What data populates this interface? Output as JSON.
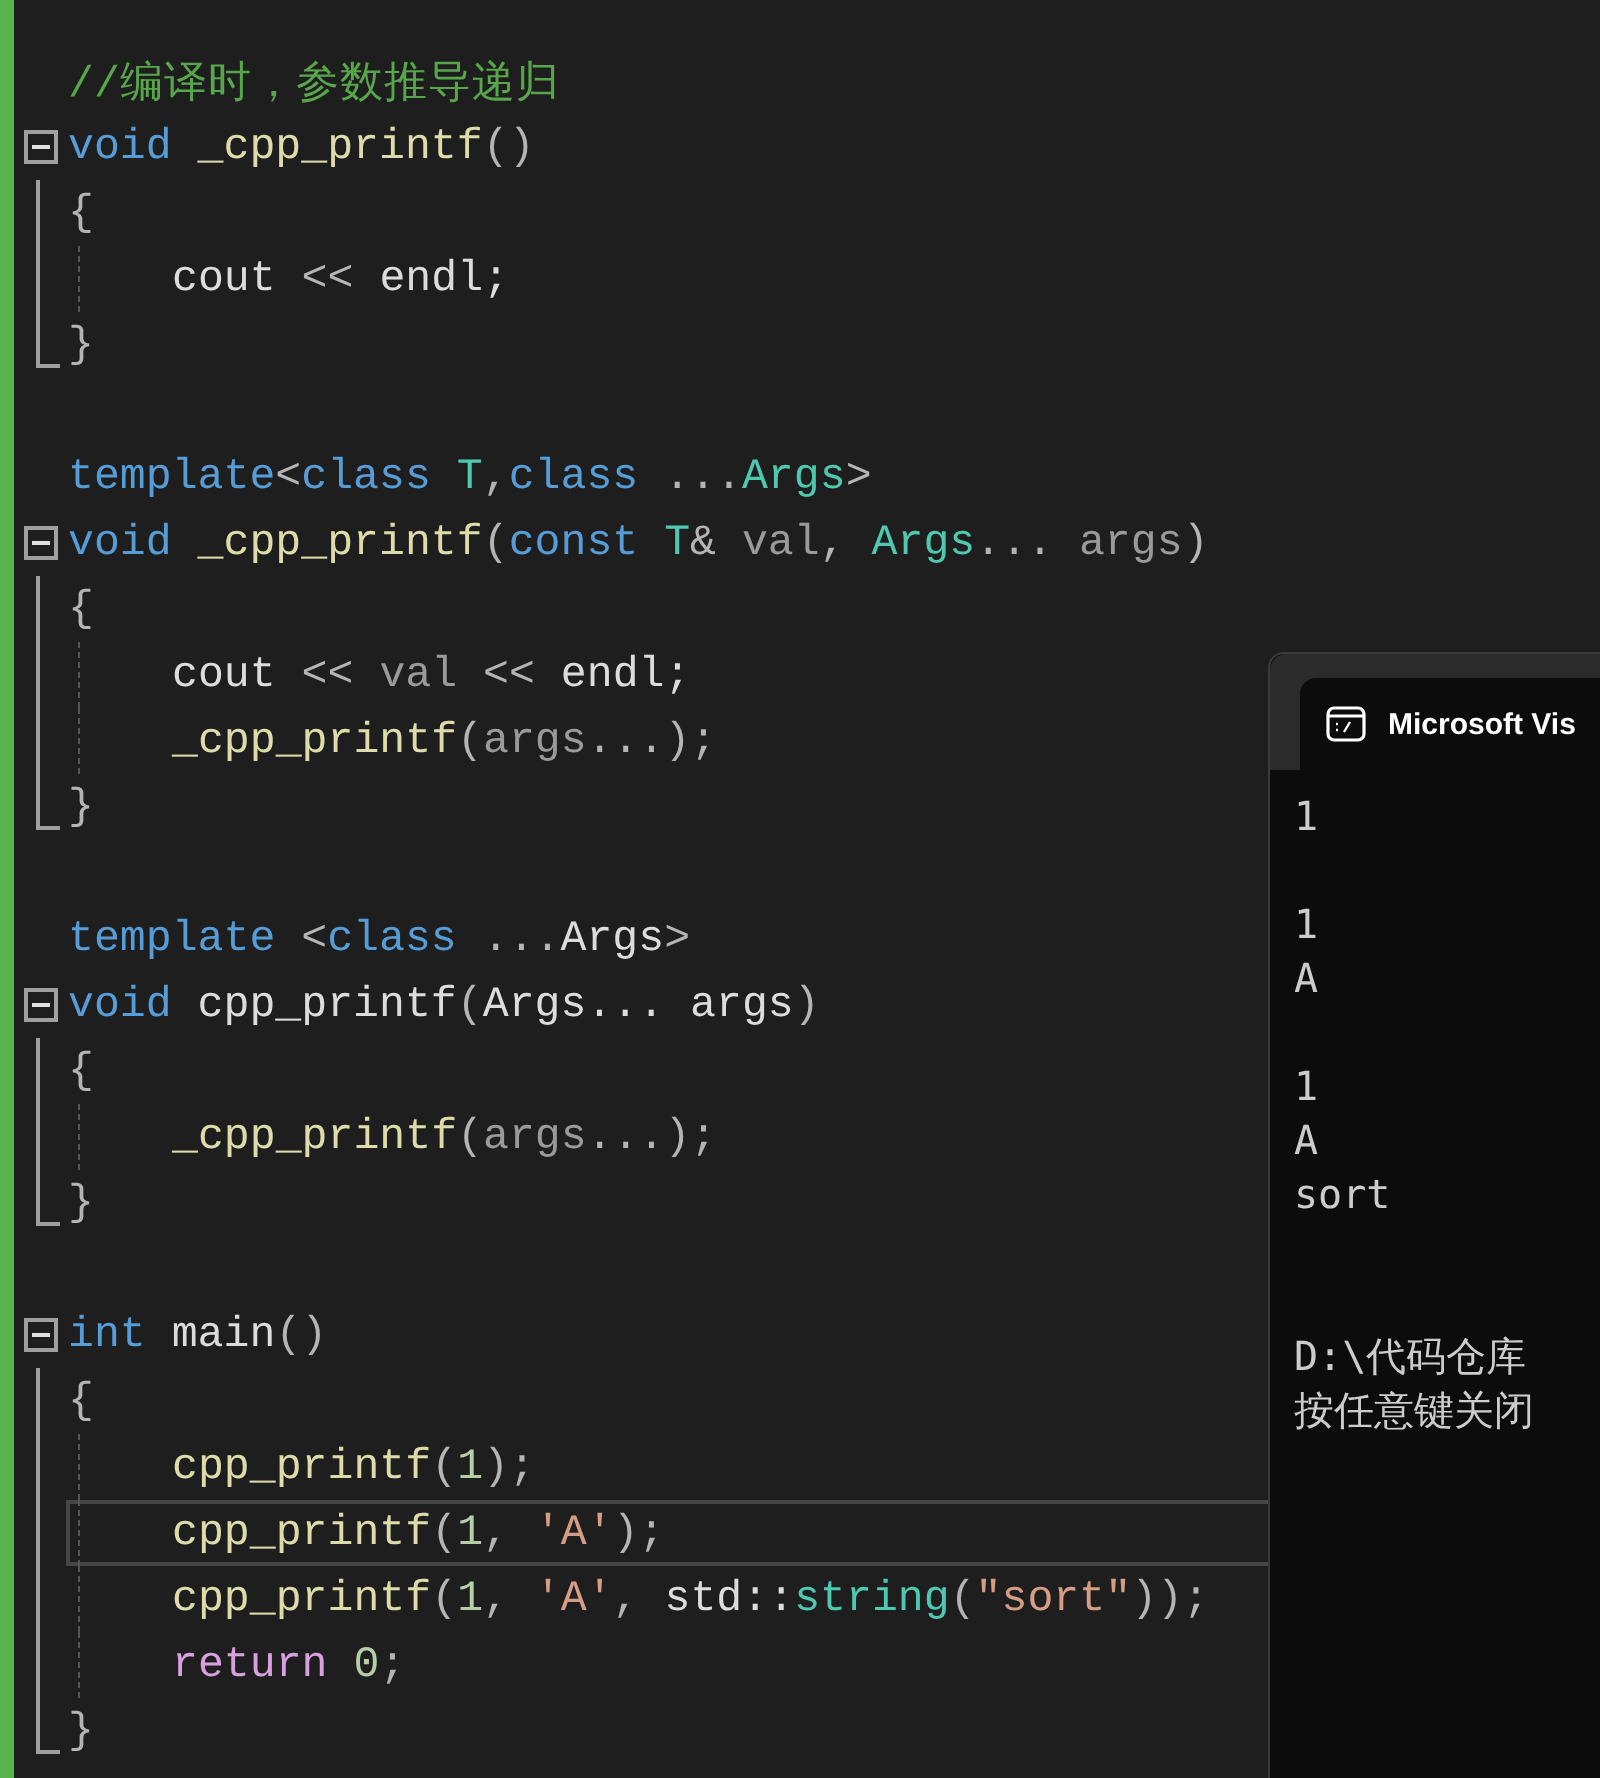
{
  "editor": {
    "lines": [
      {
        "kind": "plain",
        "indented": false,
        "current": false,
        "tokens": [
          {
            "kind": "comment",
            "text": "//编译时，参数推导递归"
          }
        ]
      },
      {
        "kind": "fold-start",
        "indented": false,
        "current": false,
        "tokens": [
          {
            "kind": "keyword",
            "text": "void"
          },
          {
            "kind": "func",
            "text": " _cpp_printf"
          },
          {
            "kind": "punct",
            "text": "()"
          }
        ]
      },
      {
        "kind": "fold-line",
        "indented": false,
        "current": false,
        "tokens": [
          {
            "kind": "punct",
            "text": "{"
          }
        ]
      },
      {
        "kind": "fold-line",
        "indented": true,
        "current": false,
        "tokens": [
          {
            "kind": "plain",
            "text": "cout"
          },
          {
            "kind": "punct",
            "text": " << "
          },
          {
            "kind": "plain",
            "text": "endl;"
          }
        ]
      },
      {
        "kind": "fold-end",
        "indented": false,
        "current": false,
        "tokens": [
          {
            "kind": "punct",
            "text": "}"
          }
        ]
      },
      {
        "kind": "blank"
      },
      {
        "kind": "plain",
        "indented": false,
        "current": false,
        "tokens": [
          {
            "kind": "keyword",
            "text": "template"
          },
          {
            "kind": "punct",
            "text": "<"
          },
          {
            "kind": "keyword",
            "text": "class"
          },
          {
            "kind": "type",
            "text": " T"
          },
          {
            "kind": "punct",
            "text": ","
          },
          {
            "kind": "keyword",
            "text": "class"
          },
          {
            "kind": "punct",
            "text": " ..."
          },
          {
            "kind": "type",
            "text": "Args"
          },
          {
            "kind": "punct",
            "text": ">"
          }
        ]
      },
      {
        "kind": "fold-start",
        "indented": false,
        "current": false,
        "tokens": [
          {
            "kind": "keyword",
            "text": "void"
          },
          {
            "kind": "func",
            "text": " _cpp_printf"
          },
          {
            "kind": "punct",
            "text": "("
          },
          {
            "kind": "keyword",
            "text": "const"
          },
          {
            "kind": "type",
            "text": " T"
          },
          {
            "kind": "punct",
            "text": "&"
          },
          {
            "kind": "param",
            "text": " val"
          },
          {
            "kind": "punct",
            "text": ", "
          },
          {
            "kind": "type",
            "text": "Args"
          },
          {
            "kind": "punct",
            "text": "... "
          },
          {
            "kind": "param",
            "text": "args"
          },
          {
            "kind": "punct",
            "text": ")"
          }
        ]
      },
      {
        "kind": "fold-line",
        "indented": false,
        "current": false,
        "tokens": [
          {
            "kind": "punct",
            "text": "{"
          }
        ]
      },
      {
        "kind": "fold-line",
        "indented": true,
        "current": false,
        "tokens": [
          {
            "kind": "plain",
            "text": "cout"
          },
          {
            "kind": "punct",
            "text": " << "
          },
          {
            "kind": "param",
            "text": "val"
          },
          {
            "kind": "punct",
            "text": " << "
          },
          {
            "kind": "plain",
            "text": "endl;"
          }
        ]
      },
      {
        "kind": "fold-line",
        "indented": true,
        "current": false,
        "tokens": [
          {
            "kind": "func",
            "text": "_cpp_printf"
          },
          {
            "kind": "punct",
            "text": "("
          },
          {
            "kind": "param",
            "text": "args"
          },
          {
            "kind": "punct",
            "text": "...);"
          }
        ]
      },
      {
        "kind": "fold-end",
        "indented": false,
        "current": false,
        "tokens": [
          {
            "kind": "punct",
            "text": "}"
          }
        ]
      },
      {
        "kind": "blank"
      },
      {
        "kind": "plain",
        "indented": false,
        "current": false,
        "tokens": [
          {
            "kind": "keyword",
            "text": "template"
          },
          {
            "kind": "punct",
            "text": " <"
          },
          {
            "kind": "keyword",
            "text": "class"
          },
          {
            "kind": "punct",
            "text": " ..."
          },
          {
            "kind": "plain",
            "text": "Args"
          },
          {
            "kind": "punct",
            "text": ">"
          }
        ]
      },
      {
        "kind": "fold-start",
        "indented": false,
        "current": false,
        "tokens": [
          {
            "kind": "keyword",
            "text": "void"
          },
          {
            "kind": "plain",
            "text": " cpp_printf"
          },
          {
            "kind": "punct",
            "text": "("
          },
          {
            "kind": "plain",
            "text": "Args... args"
          },
          {
            "kind": "punct",
            "text": ")"
          }
        ]
      },
      {
        "kind": "fold-line",
        "indented": false,
        "current": false,
        "tokens": [
          {
            "kind": "punct",
            "text": "{"
          }
        ]
      },
      {
        "kind": "fold-line",
        "indented": true,
        "current": false,
        "tokens": [
          {
            "kind": "func",
            "text": "_cpp_printf"
          },
          {
            "kind": "punct",
            "text": "("
          },
          {
            "kind": "param",
            "text": "args"
          },
          {
            "kind": "punct",
            "text": "...);"
          }
        ]
      },
      {
        "kind": "fold-end",
        "indented": false,
        "current": false,
        "tokens": [
          {
            "kind": "punct",
            "text": "}"
          }
        ]
      },
      {
        "kind": "blank"
      },
      {
        "kind": "fold-start",
        "indented": false,
        "current": false,
        "tokens": [
          {
            "kind": "keyword",
            "text": "int"
          },
          {
            "kind": "plain",
            "text": " main"
          },
          {
            "kind": "punct",
            "text": "()"
          }
        ]
      },
      {
        "kind": "fold-line",
        "indented": false,
        "current": false,
        "tokens": [
          {
            "kind": "punct",
            "text": "{"
          }
        ]
      },
      {
        "kind": "fold-line",
        "indented": true,
        "current": false,
        "tokens": [
          {
            "kind": "func",
            "text": "cpp_printf"
          },
          {
            "kind": "punct",
            "text": "("
          },
          {
            "kind": "number",
            "text": "1"
          },
          {
            "kind": "punct",
            "text": ");"
          }
        ]
      },
      {
        "kind": "fold-line",
        "indented": true,
        "current": true,
        "tokens": [
          {
            "kind": "func",
            "text": "cpp_printf"
          },
          {
            "kind": "punct",
            "text": "("
          },
          {
            "kind": "number",
            "text": "1"
          },
          {
            "kind": "punct",
            "text": ", "
          },
          {
            "kind": "string",
            "text": "'A'"
          },
          {
            "kind": "punct",
            "text": ");"
          }
        ]
      },
      {
        "kind": "fold-line",
        "indented": true,
        "current": false,
        "tokens": [
          {
            "kind": "func",
            "text": "cpp_printf"
          },
          {
            "kind": "punct",
            "text": "("
          },
          {
            "kind": "number",
            "text": "1"
          },
          {
            "kind": "punct",
            "text": ", "
          },
          {
            "kind": "string",
            "text": "'A'"
          },
          {
            "kind": "punct",
            "text": ", "
          },
          {
            "kind": "plain",
            "text": "std::"
          },
          {
            "kind": "type",
            "text": "string"
          },
          {
            "kind": "punct",
            "text": "("
          },
          {
            "kind": "string",
            "text": "\"sort\""
          },
          {
            "kind": "punct",
            "text": "));"
          }
        ]
      },
      {
        "kind": "fold-line",
        "indented": true,
        "current": false,
        "tokens": [
          {
            "kind": "control",
            "text": "return"
          },
          {
            "kind": "number",
            "text": " 0"
          },
          {
            "kind": "punct",
            "text": ";"
          }
        ]
      },
      {
        "kind": "fold-end",
        "indented": false,
        "current": false,
        "tokens": [
          {
            "kind": "punct",
            "text": "}"
          }
        ]
      }
    ]
  },
  "console": {
    "title": "Microsoft Vis",
    "lines": [
      {
        "kind": "text",
        "text": "1"
      },
      {
        "kind": "blank"
      },
      {
        "kind": "text",
        "text": "1"
      },
      {
        "kind": "text",
        "text": "A"
      },
      {
        "kind": "blank"
      },
      {
        "kind": "text",
        "text": "1"
      },
      {
        "kind": "text",
        "text": "A"
      },
      {
        "kind": "text",
        "text": "sort"
      },
      {
        "kind": "blank"
      },
      {
        "kind": "blank"
      },
      {
        "kind": "text",
        "text": "D:\\代码仓库"
      },
      {
        "kind": "text",
        "text": "按任意键关闭"
      }
    ]
  }
}
